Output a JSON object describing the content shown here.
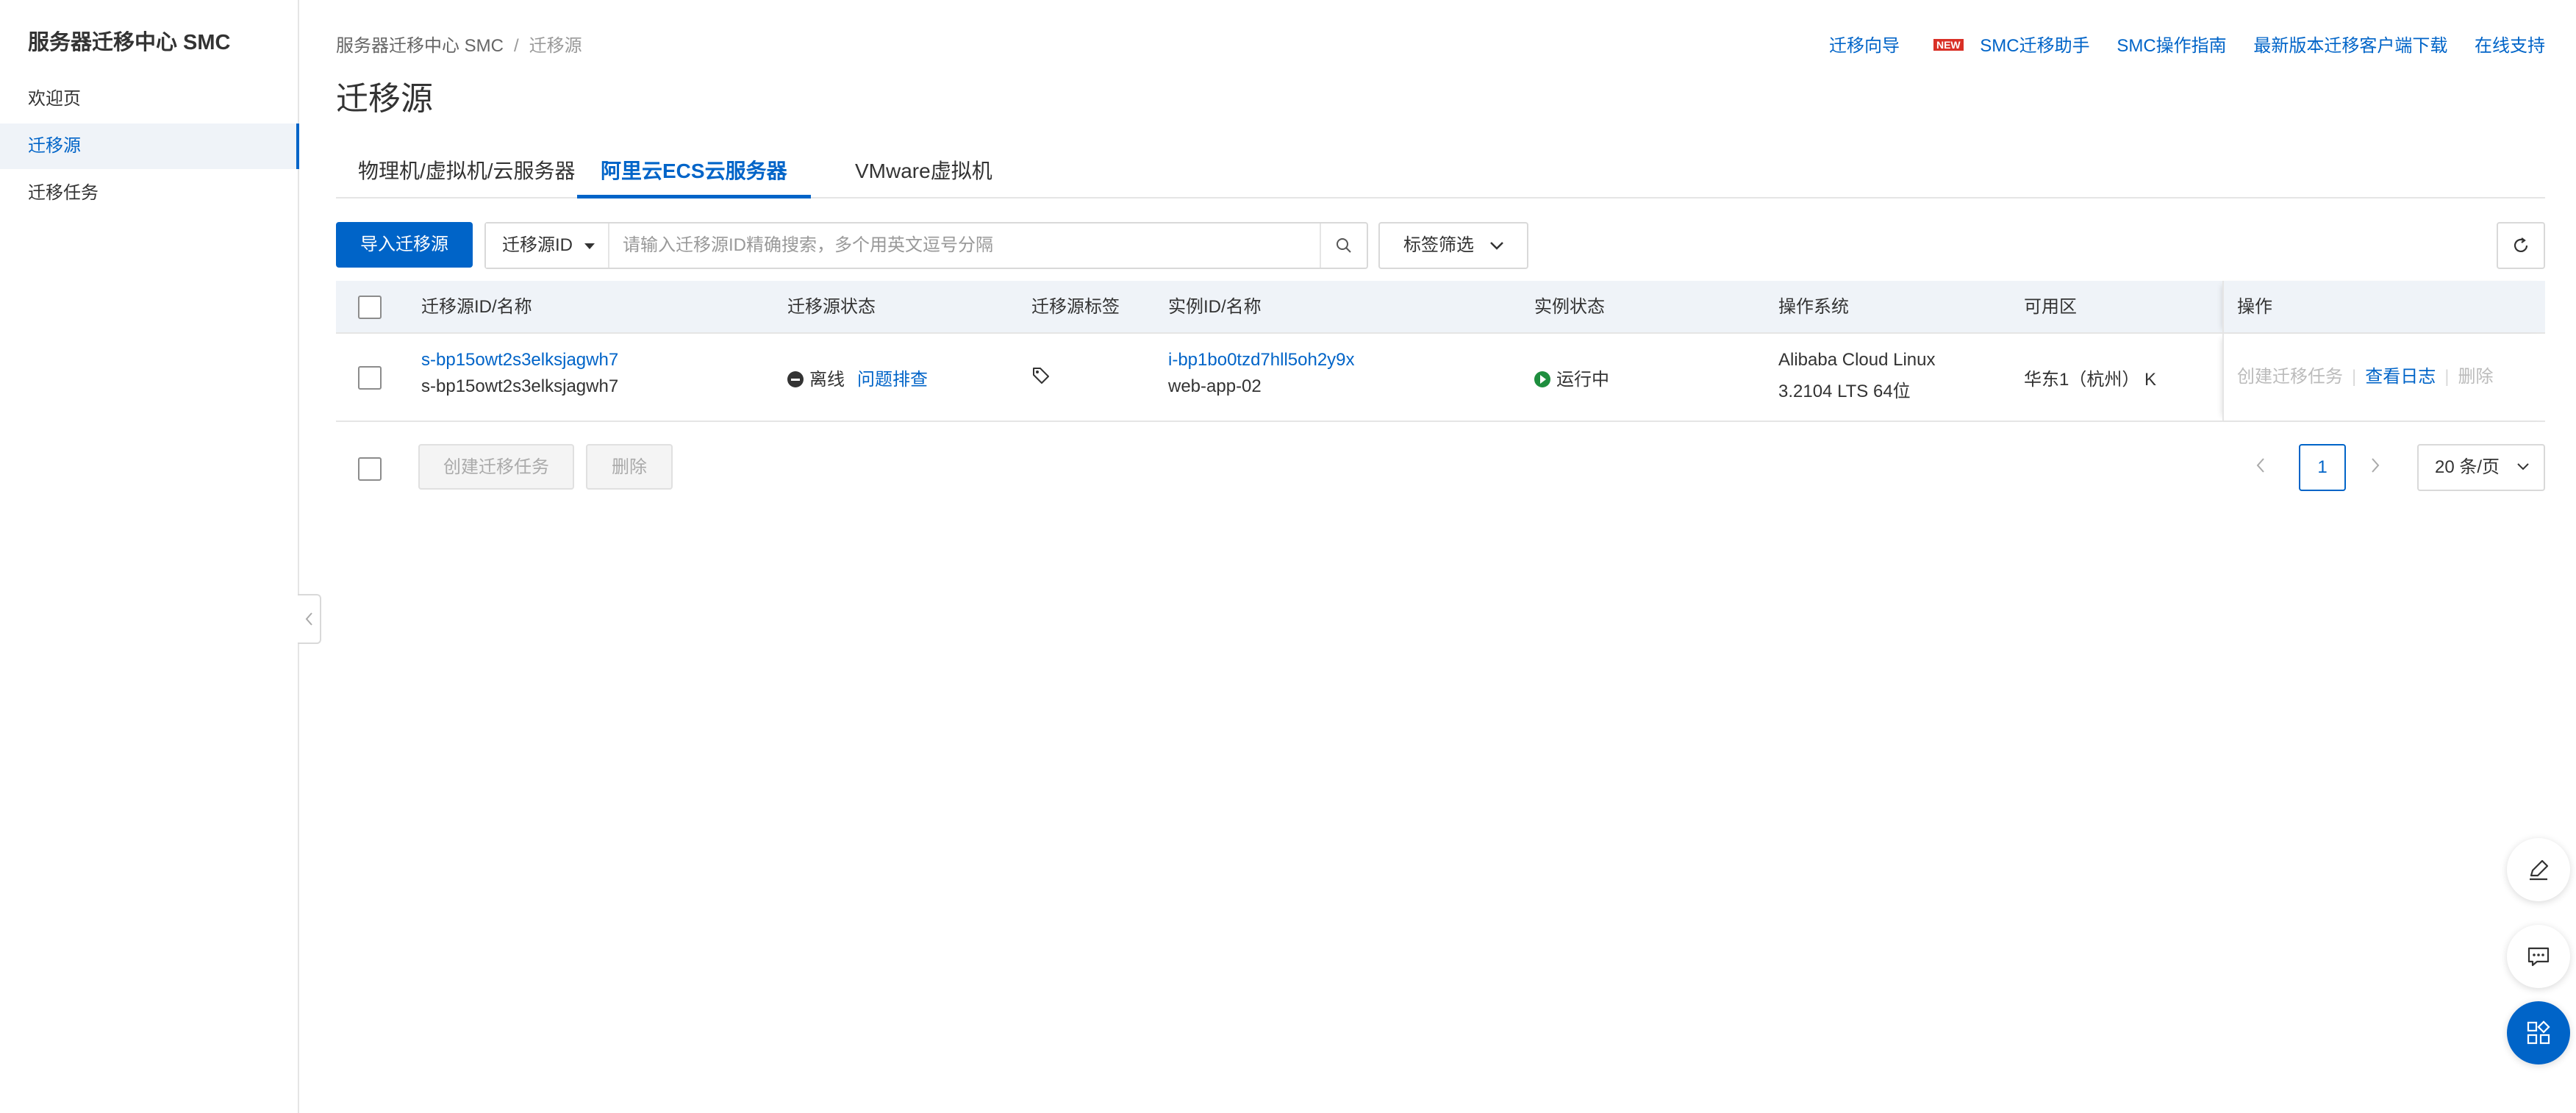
{
  "sidebar": {
    "title": "服务器迁移中心 SMC",
    "items": [
      {
        "label": "欢迎页"
      },
      {
        "label": "迁移源"
      },
      {
        "label": "迁移任务"
      }
    ]
  },
  "breadcrumb": {
    "root": "服务器迁移中心 SMC",
    "separator": "/",
    "current": "迁移源"
  },
  "top_links": {
    "guide": "迁移向导",
    "guide_badge": "NEW",
    "assistant": "SMC迁移助手",
    "manual": "SMC操作指南",
    "download": "最新版本迁移客户端下载",
    "support": "在线支持"
  },
  "page_title": "迁移源",
  "tabs": [
    {
      "label": "物理机/虚拟机/云服务器",
      "active": false
    },
    {
      "label": "阿里云ECS云服务器",
      "active": true
    },
    {
      "label": "VMware虚拟机",
      "active": false
    }
  ],
  "toolbar": {
    "import_label": "导入迁移源",
    "search_field": "迁移源ID",
    "search_placeholder": "请输入迁移源ID精确搜索，多个用英文逗号分隔",
    "tag_filter_label": "标签筛选"
  },
  "table": {
    "columns": {
      "source": "迁移源ID/名称",
      "source_status": "迁移源状态",
      "source_tags": "迁移源标签",
      "instance": "实例ID/名称",
      "instance_status": "实例状态",
      "os": "操作系统",
      "zone": "可用区",
      "ops": "操作"
    },
    "rows": [
      {
        "source_id": "s-bp15owt2s3elksjagwh7",
        "source_name": "s-bp15owt2s3elksjagwh7",
        "source_status": "离线",
        "troubleshoot": "问题排查",
        "instance_id": "i-bp1bo0tzd7hll5oh2y9x",
        "instance_name": "web-app-02",
        "instance_status": "运行中",
        "os_line1": "Alibaba Cloud Linux",
        "os_line2": "3.2104 LTS 64位",
        "zone": "华东1（杭州） K",
        "op_create": "创建迁移任务",
        "op_log": "查看日志",
        "op_delete": "删除"
      }
    ]
  },
  "footer": {
    "create_task": "创建迁移任务",
    "delete": "删除",
    "current_page": "1",
    "page_size": "20 条/页"
  },
  "colors": {
    "primary": "#0064c8",
    "running": "#1e8e3e",
    "header_bg": "#eff3f8"
  }
}
